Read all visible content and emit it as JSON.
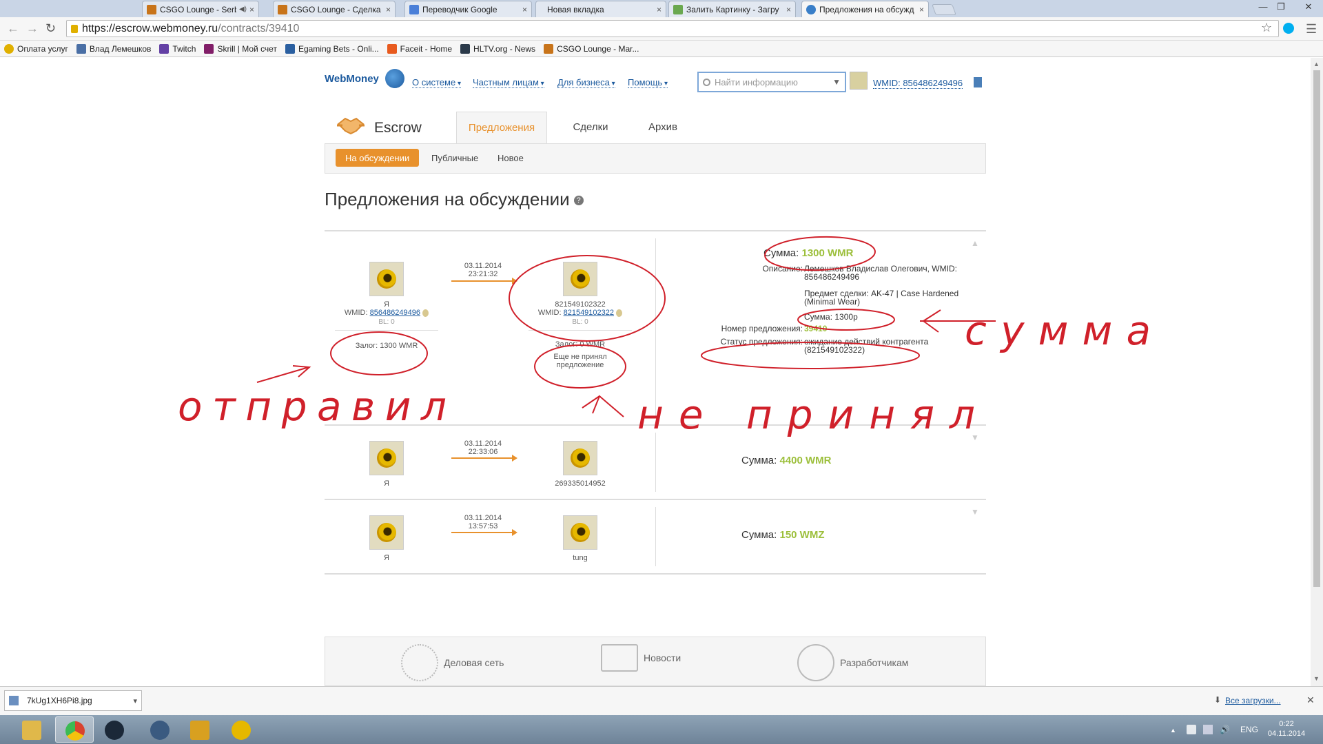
{
  "browser": {
    "tabs": [
      {
        "title": "CSGO Lounge - Serbia",
        "favicon_color": "#c8741a",
        "has_audio": true
      },
      {
        "title": "CSGO Lounge - Сделка за",
        "favicon_color": "#c8741a"
      },
      {
        "title": "Переводчик Google",
        "favicon_color": "#4a7fd8"
      },
      {
        "title": "Новая вкладка",
        "favicon_color": ""
      },
      {
        "title": "Залить Картинку - Загру",
        "favicon_color": "#6aa84f"
      },
      {
        "title": "Предложения на обсужд",
        "favicon_color": "#3a7fc8",
        "active": true
      }
    ],
    "close_glyph": "×",
    "window_buttons": [
      "—",
      "❐",
      "✕"
    ],
    "url_host": "https://escrow.webmoney.ru",
    "url_path": "/contracts/39410",
    "back_glyph": "←",
    "forward_glyph": "→",
    "reload_glyph": "↻",
    "star_glyph": "☆",
    "menu_glyph": "☰",
    "bookmarks": [
      {
        "label": "Оплата услуг",
        "icon_color": "#e0b000"
      },
      {
        "label": "Влад Лемешков",
        "icon_color": "#4a6fa5"
      },
      {
        "label": "Twitch",
        "icon_color": "#6441a5"
      },
      {
        "label": "Skrill | Мой счет",
        "icon_color": "#811e68"
      },
      {
        "label": "Egaming Bets - Onli...",
        "icon_color": "#2a5fa0"
      },
      {
        "label": "Faceit - Home",
        "icon_color": "#e85a1e"
      },
      {
        "label": "HLTV.org - News",
        "icon_color": "#2b3a4a"
      },
      {
        "label": "CSGO Lounge - Mar...",
        "icon_color": "#c8741a"
      }
    ]
  },
  "header": {
    "logo": "WebMoney",
    "menu": [
      "О системе",
      "Частным лицам",
      "Для бизнеса",
      "Помощь"
    ],
    "search_placeholder": "Найти информацию",
    "wmid_label": "WMID: 856486249496"
  },
  "escrow": {
    "title": "Escrow",
    "tabs": [
      "Предложения",
      "Сделки",
      "Архив"
    ],
    "active_tab": "Предложения",
    "subtabs": [
      "На обсуждении",
      "Публичные",
      "Новое"
    ],
    "active_subtab": "На обсуждении"
  },
  "page_title": "Предложения на обсуждении",
  "help_glyph": "?",
  "deals": [
    {
      "expanded": true,
      "date": "03.11.2014",
      "time": "23:21:32",
      "left": {
        "name": "Я",
        "wmid_label": "WMID:",
        "wmid": "856486249496",
        "bl": "BL: 0",
        "zalog": "Залог: 1300 WMR"
      },
      "right": {
        "name": "821549102322",
        "wmid_label": "WMID:",
        "wmid": "821549102322",
        "bl": "BL: 0",
        "zalog": "Залог: 0 WMR",
        "note_line1": "Еще не принял",
        "note_line2": "предложение"
      },
      "sum_label": "Сумма:",
      "sum_value": "1300 WMR",
      "desc_label": "Описание:",
      "desc_line1": "Лемешков Владислав Олегович, WMID:",
      "desc_line2": "856486249496",
      "subject_line1": "Предмет сделки: AK-47 | Case Hardened",
      "subject_line2": "(Minimal Wear)",
      "amount_text": "Сумма: 1300р",
      "number_label": "Номер предложения:",
      "number_value": "39410",
      "status_label": "Статус предложения:",
      "status_line1": "ожидание действий контрагента",
      "status_line2": "(821549102322)",
      "toggle_glyph": "▲"
    },
    {
      "expanded": false,
      "date": "03.11.2014",
      "time": "22:33:06",
      "left": {
        "name": "Я"
      },
      "right": {
        "name": "269335014952"
      },
      "sum_label": "Сумма:",
      "sum_value": "4400 WMR",
      "toggle_glyph": "▼"
    },
    {
      "expanded": false,
      "date": "03.11.2014",
      "time": "13:57:53",
      "left": {
        "name": "Я"
      },
      "right": {
        "name": "tung"
      },
      "sum_label": "Сумма:",
      "sum_value": "150 WMZ",
      "toggle_glyph": "▼"
    }
  ],
  "footer": [
    "Деловая сеть",
    "Новости",
    "Разработчикам"
  ],
  "annotations": {
    "color": "#d0202a",
    "sent": "отправил",
    "not_accepted": "не принял",
    "sum": "сумма"
  },
  "downloads": {
    "file": "7kUg1XH6Pi8.jpg",
    "arrow": "▾",
    "all_label": "Все загрузки...",
    "close": "✕"
  },
  "taskbar": {
    "apps": [
      {
        "name": "explorer",
        "color": "#e0b84a"
      },
      {
        "name": "chrome",
        "color": "#d9432f",
        "active": true
      },
      {
        "name": "steam",
        "color": "#1b2838"
      },
      {
        "name": "teamspeak",
        "color": "#3a5a80"
      },
      {
        "name": "csgo",
        "color": "#d8a020"
      },
      {
        "name": "webmoney",
        "color": "#e6b800"
      }
    ],
    "tray_up": "▲",
    "lang": "ENG",
    "time": "0:22",
    "date": "04.11.2014"
  }
}
